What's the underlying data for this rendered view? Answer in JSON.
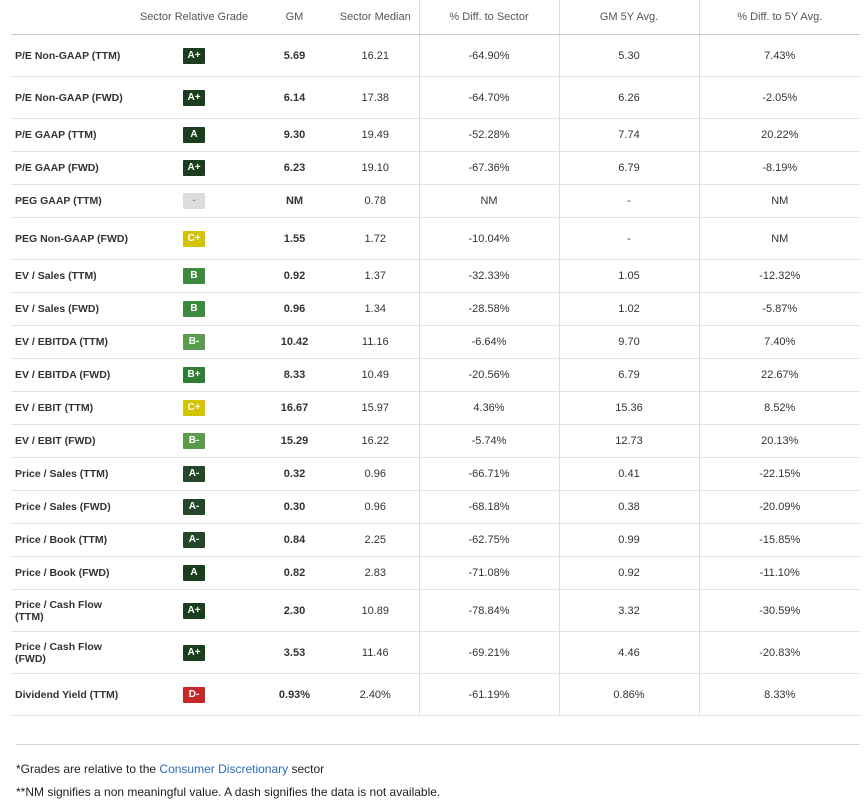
{
  "columns": [
    "",
    "Sector Relative Grade",
    "GM",
    "Sector Median",
    "% Diff. to Sector",
    "GM 5Y Avg.",
    "% Diff. to 5Y Avg."
  ],
  "grade_colors": {
    "A+": "#1a3d1d",
    "A": "#1a3d1d",
    "A-": "#24472a",
    "B+": "#2f7d32",
    "B": "#3b8a3e",
    "B-": "#5a9a4c",
    "C+": "#d4c300",
    "D-": "#c62828",
    "-": "#dcdcdc"
  },
  "rows": [
    {
      "metric": "P/E Non-GAAP (TTM)",
      "grade": "A+",
      "gm": "5.69",
      "median": "16.21",
      "diff_sector": "-64.90%",
      "avg5y": "5.30",
      "diff_5y": "7.43%"
    },
    {
      "metric": "P/E Non-GAAP (FWD)",
      "grade": "A+",
      "gm": "6.14",
      "median": "17.38",
      "diff_sector": "-64.70%",
      "avg5y": "6.26",
      "diff_5y": "-2.05%"
    },
    {
      "metric": "P/E GAAP (TTM)",
      "grade": "A",
      "gm": "9.30",
      "median": "19.49",
      "diff_sector": "-52.28%",
      "avg5y": "7.74",
      "diff_5y": "20.22%"
    },
    {
      "metric": "P/E GAAP (FWD)",
      "grade": "A+",
      "gm": "6.23",
      "median": "19.10",
      "diff_sector": "-67.36%",
      "avg5y": "6.79",
      "diff_5y": "-8.19%"
    },
    {
      "metric": "PEG GAAP (TTM)",
      "grade": "-",
      "gm": "NM",
      "median": "0.78",
      "diff_sector": "NM",
      "avg5y": "-",
      "diff_5y": "NM"
    },
    {
      "metric": "PEG Non-GAAP (FWD)",
      "grade": "C+",
      "gm": "1.55",
      "median": "1.72",
      "diff_sector": "-10.04%",
      "avg5y": "-",
      "diff_5y": "NM"
    },
    {
      "metric": "EV / Sales (TTM)",
      "grade": "B",
      "gm": "0.92",
      "median": "1.37",
      "diff_sector": "-32.33%",
      "avg5y": "1.05",
      "diff_5y": "-12.32%"
    },
    {
      "metric": "EV / Sales (FWD)",
      "grade": "B",
      "gm": "0.96",
      "median": "1.34",
      "diff_sector": "-28.58%",
      "avg5y": "1.02",
      "diff_5y": "-5.87%"
    },
    {
      "metric": "EV / EBITDA (TTM)",
      "grade": "B-",
      "gm": "10.42",
      "median": "11.16",
      "diff_sector": "-6.64%",
      "avg5y": "9.70",
      "diff_5y": "7.40%"
    },
    {
      "metric": "EV / EBITDA (FWD)",
      "grade": "B+",
      "gm": "8.33",
      "median": "10.49",
      "diff_sector": "-20.56%",
      "avg5y": "6.79",
      "diff_5y": "22.67%"
    },
    {
      "metric": "EV / EBIT (TTM)",
      "grade": "C+",
      "gm": "16.67",
      "median": "15.97",
      "diff_sector": "4.36%",
      "avg5y": "15.36",
      "diff_5y": "8.52%"
    },
    {
      "metric": "EV / EBIT (FWD)",
      "grade": "B-",
      "gm": "15.29",
      "median": "16.22",
      "diff_sector": "-5.74%",
      "avg5y": "12.73",
      "diff_5y": "20.13%"
    },
    {
      "metric": "Price / Sales (TTM)",
      "grade": "A-",
      "gm": "0.32",
      "median": "0.96",
      "diff_sector": "-66.71%",
      "avg5y": "0.41",
      "diff_5y": "-22.15%"
    },
    {
      "metric": "Price / Sales (FWD)",
      "grade": "A-",
      "gm": "0.30",
      "median": "0.96",
      "diff_sector": "-68.18%",
      "avg5y": "0.38",
      "diff_5y": "-20.09%"
    },
    {
      "metric": "Price / Book (TTM)",
      "grade": "A-",
      "gm": "0.84",
      "median": "2.25",
      "diff_sector": "-62.75%",
      "avg5y": "0.99",
      "diff_5y": "-15.85%"
    },
    {
      "metric": "Price / Book (FWD)",
      "grade": "A",
      "gm": "0.82",
      "median": "2.83",
      "diff_sector": "-71.08%",
      "avg5y": "0.92",
      "diff_5y": "-11.10%"
    },
    {
      "metric": "Price / Cash Flow (TTM)",
      "grade": "A+",
      "gm": "2.30",
      "median": "10.89",
      "diff_sector": "-78.84%",
      "avg5y": "3.32",
      "diff_5y": "-30.59%"
    },
    {
      "metric": "Price / Cash Flow (FWD)",
      "grade": "A+",
      "gm": "3.53",
      "median": "11.46",
      "diff_sector": "-69.21%",
      "avg5y": "4.46",
      "diff_5y": "-20.83%"
    },
    {
      "metric": "Dividend Yield (TTM)",
      "grade": "D-",
      "gm": "0.93%",
      "median": "2.40%",
      "diff_sector": "-61.19%",
      "avg5y": "0.86%",
      "diff_5y": "8.33%"
    }
  ],
  "footer": {
    "note1_prefix": "*Grades are relative to the ",
    "note1_link": "Consumer Discretionary",
    "note1_suffix": " sector",
    "note2": "**NM signifies a non meaningful value. A dash signifies the data is not available."
  }
}
